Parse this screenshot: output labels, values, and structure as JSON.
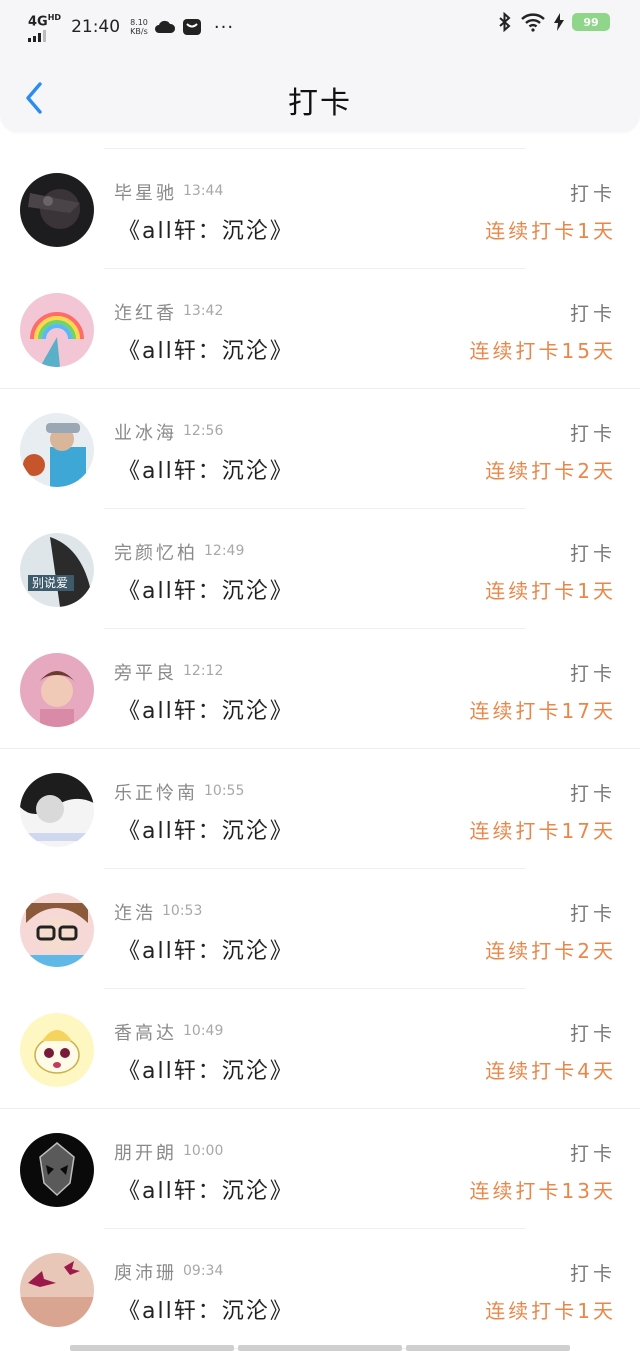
{
  "status_bar": {
    "network": "4G",
    "network_sup": "HD",
    "time": "21:40",
    "speed_value": "8.10",
    "speed_unit": "KB/s",
    "dots": "···",
    "battery": "99"
  },
  "header": {
    "title": "打卡",
    "back_icon": "chevron-left-icon"
  },
  "colors": {
    "accent": "#2b8cf0",
    "streak": "#e9874a"
  },
  "checkins": [
    {
      "name": "毕星驰",
      "time": "13:44",
      "action": "打卡",
      "book": "《all轩：沉沦》",
      "streak": "连续打卡1天",
      "avatar": "dark-photo"
    },
    {
      "name": "迮红香",
      "time": "13:42",
      "action": "打卡",
      "book": "《all轩：沉沦》",
      "streak": "连续打卡15天",
      "avatar": "rainbow"
    },
    {
      "name": "业冰海",
      "time": "12:56",
      "action": "打卡",
      "book": "《all轩：沉沦》",
      "streak": "连续打卡2天",
      "avatar": "basketball"
    },
    {
      "name": "完颜忆柏",
      "time": "12:49",
      "action": "打卡",
      "book": "《all轩：沉沦》",
      "streak": "连续打卡1天",
      "avatar": "girl-text"
    },
    {
      "name": "旁平良",
      "time": "12:12",
      "action": "打卡",
      "book": "《all轩：沉沦》",
      "streak": "连续打卡17天",
      "avatar": "boy-pink"
    },
    {
      "name": "乐正怜南",
      "time": "10:55",
      "action": "打卡",
      "book": "《all轩：沉沦》",
      "streak": "连续打卡17天",
      "avatar": "bw-girl"
    },
    {
      "name": "迮浩",
      "time": "10:53",
      "action": "打卡",
      "book": "《all轩：沉沦》",
      "streak": "连续打卡2天",
      "avatar": "glasses-boy"
    },
    {
      "name": "香高达",
      "time": "10:49",
      "action": "打卡",
      "book": "《all轩：沉沦》",
      "streak": "连续打卡4天",
      "avatar": "cartoon"
    },
    {
      "name": "朋开朗",
      "time": "10:00",
      "action": "打卡",
      "book": "《all轩：沉沦》",
      "streak": "连续打卡13天",
      "avatar": "skull"
    },
    {
      "name": "庾沛珊",
      "time": "09:34",
      "action": "打卡",
      "book": "《all轩：沉沦》",
      "streak": "连续打卡1天",
      "avatar": "crane"
    }
  ]
}
